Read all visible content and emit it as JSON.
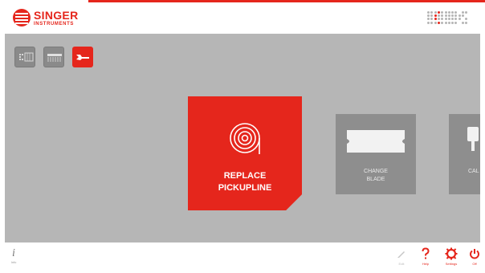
{
  "brand": {
    "name": "SINGER",
    "sub": "INSTRUMENTS",
    "accent": "#e5261c"
  },
  "mode_buttons": [
    {
      "icon": "array-icon",
      "active": false
    },
    {
      "icon": "pin-tool-icon",
      "active": false
    },
    {
      "icon": "wrench-icon",
      "active": true
    }
  ],
  "cards": [
    {
      "title": "REPLACE\nPICKUPLINE",
      "icon": "coil-icon",
      "selected": true
    },
    {
      "title": "CHANGE\nBLADE",
      "icon": "blade-icon",
      "selected": false
    },
    {
      "title": "CAL\nNO",
      "icon": "nozzle-icon",
      "selected": false
    }
  ],
  "bottom_bar": {
    "info_label": "Info",
    "items": [
      {
        "label": "Edit",
        "icon": "pencil-icon",
        "enabled": false
      },
      {
        "label": "Help",
        "icon": "help-icon",
        "enabled": true
      },
      {
        "label": "Settings",
        "icon": "gear-icon",
        "enabled": true
      },
      {
        "label": "Off",
        "icon": "power-icon",
        "enabled": true
      }
    ]
  },
  "colors": {
    "panel_bg": "#b6b6b6",
    "card_grey": "#8e8e8e",
    "accent": "#e5261c"
  }
}
